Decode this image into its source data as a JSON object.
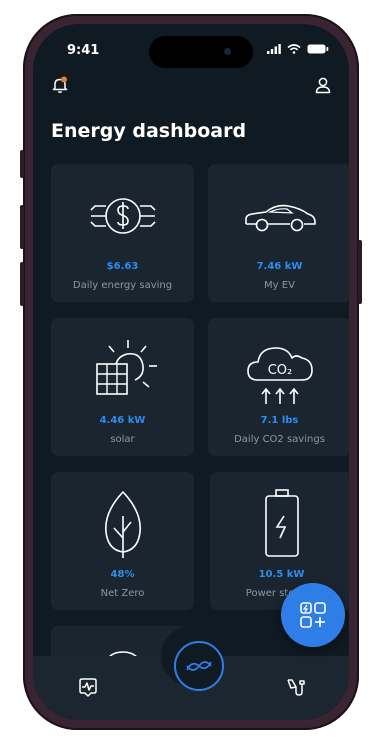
{
  "status": {
    "time": "9:41"
  },
  "header": {
    "title": "Energy dashboard"
  },
  "icons": {
    "notification": "bell-icon",
    "profile": "user-icon",
    "fab": "add-widget-icon",
    "nav_left": "activity-icon",
    "nav_center": "energy-flow-icon",
    "nav_right": "charger-plug-icon"
  },
  "colors": {
    "accent": "#2f7ee8",
    "value": "#2a8ef0",
    "notification_dot": "#f07a2a"
  },
  "cards": [
    {
      "value": "$6.63",
      "label": "Daily energy saving",
      "icon": "money-icon"
    },
    {
      "value": "7.46 kW",
      "label": "My EV",
      "icon": "car-icon"
    },
    {
      "value": "4.46 kW",
      "label": "solar",
      "icon": "solar-panel-icon"
    },
    {
      "value": "7.1 lbs",
      "label": "Daily CO2 savings",
      "icon": "co2-cloud-icon",
      "icon_text": "CO₂"
    },
    {
      "value": "48%",
      "label": "Net Zero",
      "icon": "leaf-icon"
    },
    {
      "value": "10.5 kW",
      "label": "Power storage",
      "icon": "battery-icon"
    }
  ]
}
